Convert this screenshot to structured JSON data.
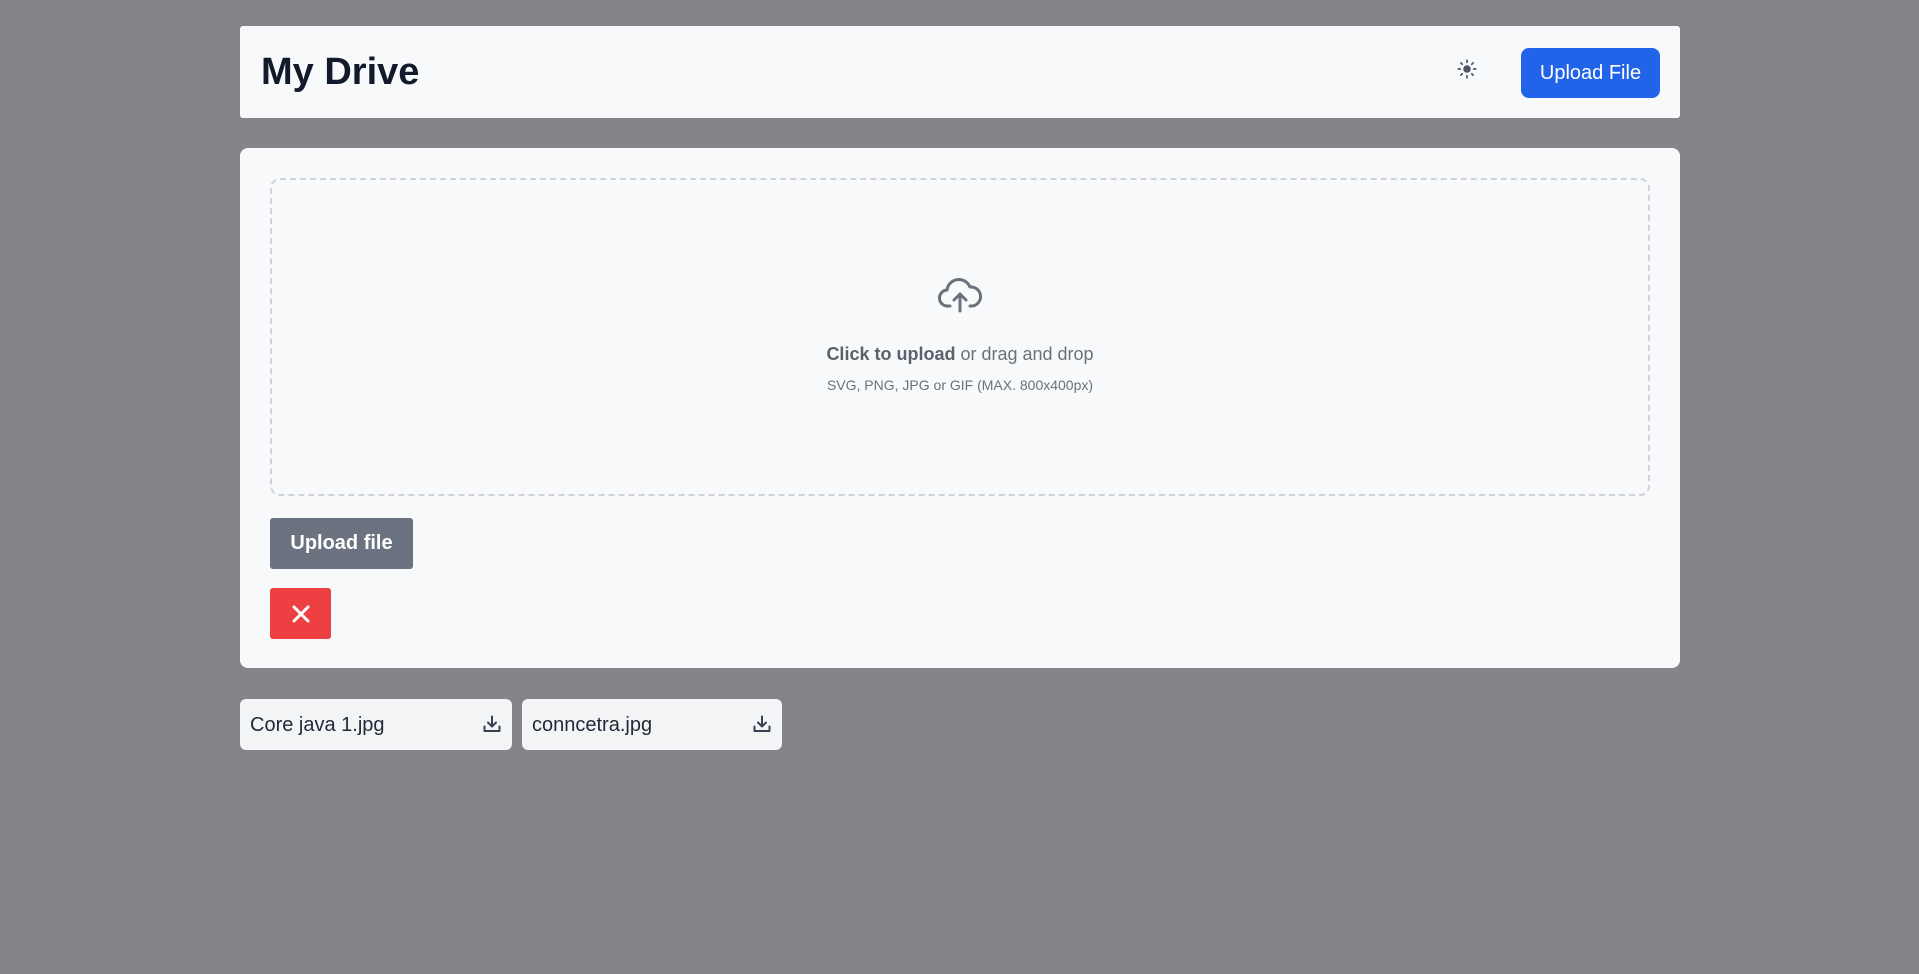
{
  "header": {
    "title": "My Drive",
    "theme_icon": "sun-icon",
    "upload_button_label": "Upload File",
    "accent_color": "#2164ea"
  },
  "dropzone": {
    "icon": "cloud-upload-icon",
    "click_text": "Click to upload",
    "drag_text": " or drag and drop",
    "hint": "SVG, PNG, JPG or GIF (MAX. 800x400px)"
  },
  "actions": {
    "upload_label": "Upload file",
    "cancel_icon": "close-icon",
    "cancel_color": "#ee4043"
  },
  "files": [
    {
      "name": "Core java 1.jpg",
      "icon": "download-icon"
    },
    {
      "name": "conncetra.jpg",
      "icon": "download-icon"
    }
  ]
}
